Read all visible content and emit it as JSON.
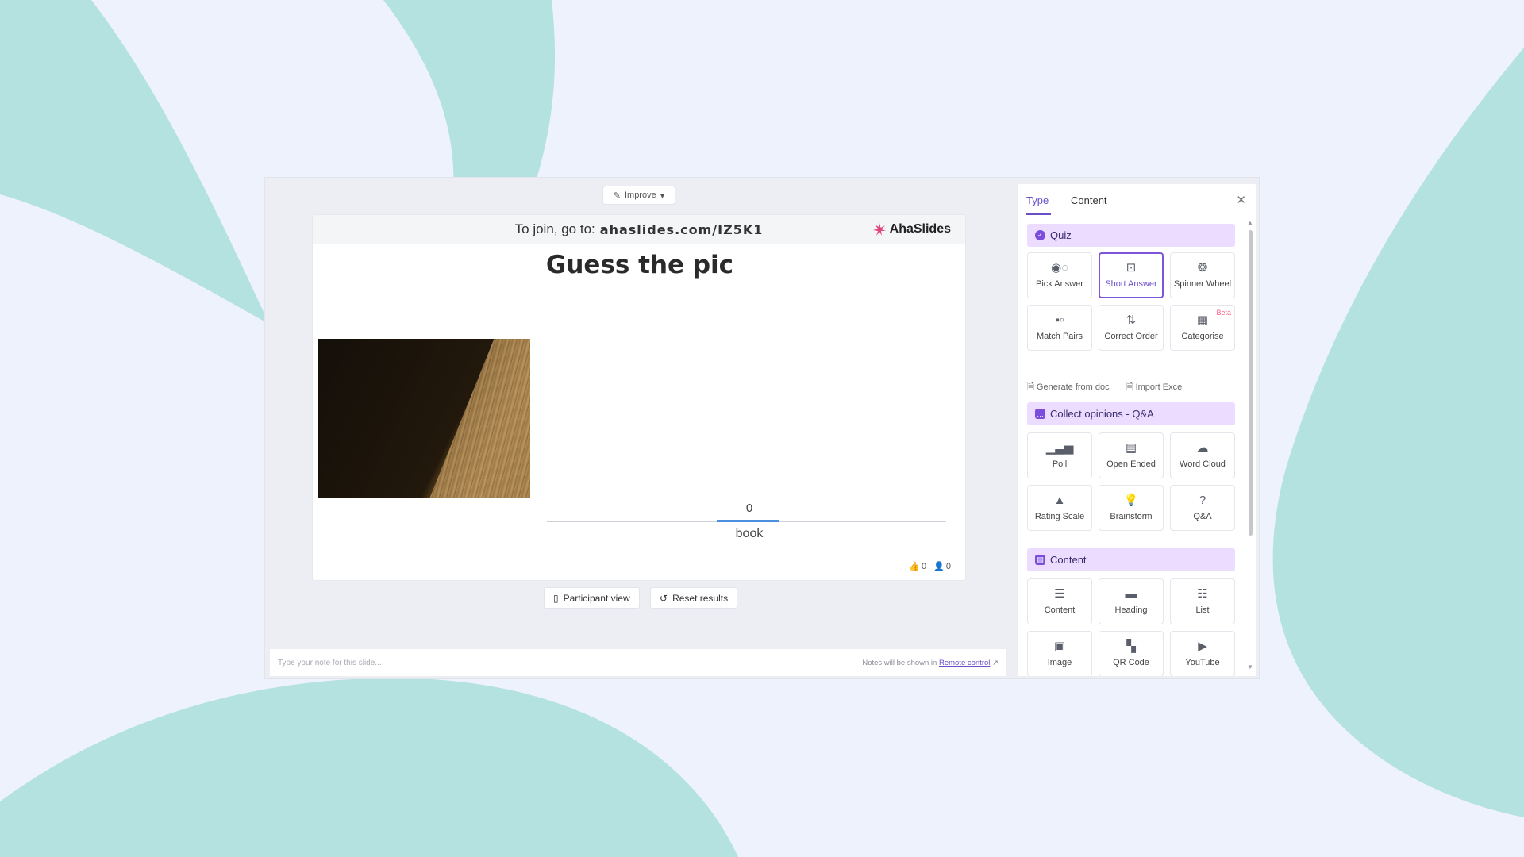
{
  "colors": {
    "background": "#eef2fc",
    "blob": "#b3e2e1",
    "accent": "#6a4fc8",
    "section_bg": "#ecdcff",
    "bar": "#4f8fe0",
    "beta": "#ff5d86"
  },
  "toolbar": {
    "improve_label": "Improve",
    "improve_icon": "magic-wand-icon"
  },
  "slide": {
    "join_prefix": "To join, go to:",
    "join_url": "ahaslides.com/IZ5K1",
    "brand": "AhaSlides",
    "title": "Guess the pic",
    "result_count": "0",
    "answer_label": "book",
    "likes_count": "0",
    "participants_count": "0"
  },
  "actions": {
    "participant_view": "Participant view",
    "reset_results": "Reset results"
  },
  "notes": {
    "placeholder": "Type your note for this slide...",
    "info_prefix": "Notes will be shown in",
    "info_link": "Remote control"
  },
  "panel": {
    "tabs": [
      {
        "label": "Type",
        "active": true
      },
      {
        "label": "Content",
        "active": false
      }
    ],
    "sections": {
      "quiz": {
        "label": "Quiz",
        "items": [
          {
            "label": "Pick Answer",
            "icon": "pick-answer-icon"
          },
          {
            "label": "Short Answer",
            "icon": "short-answer-icon",
            "selected": true
          },
          {
            "label": "Spinner Wheel",
            "icon": "spinner-wheel-icon"
          },
          {
            "label": "Match Pairs",
            "icon": "match-pairs-icon"
          },
          {
            "label": "Correct Order",
            "icon": "correct-order-icon"
          },
          {
            "label": "Categorise",
            "icon": "categorise-icon",
            "badge": "Beta"
          }
        ],
        "generate_label": "Generate from doc",
        "import_label": "Import Excel"
      },
      "opinions": {
        "label": "Collect opinions - Q&A",
        "items": [
          {
            "label": "Poll",
            "icon": "bar-chart-icon"
          },
          {
            "label": "Open Ended",
            "icon": "open-ended-icon"
          },
          {
            "label": "Word Cloud",
            "icon": "cloud-icon"
          },
          {
            "label": "Rating Scale",
            "icon": "rating-scale-icon"
          },
          {
            "label": "Brainstorm",
            "icon": "brainstorm-icon"
          },
          {
            "label": "Q&A",
            "icon": "qa-icon"
          }
        ]
      },
      "content": {
        "label": "Content",
        "items": [
          {
            "label": "Content",
            "icon": "content-icon"
          },
          {
            "label": "Heading",
            "icon": "heading-icon"
          },
          {
            "label": "List",
            "icon": "list-icon"
          },
          {
            "label": "Image",
            "icon": "image-icon"
          },
          {
            "label": "QR Code",
            "icon": "qr-code-icon"
          },
          {
            "label": "YouTube",
            "icon": "youtube-icon"
          }
        ]
      }
    }
  }
}
